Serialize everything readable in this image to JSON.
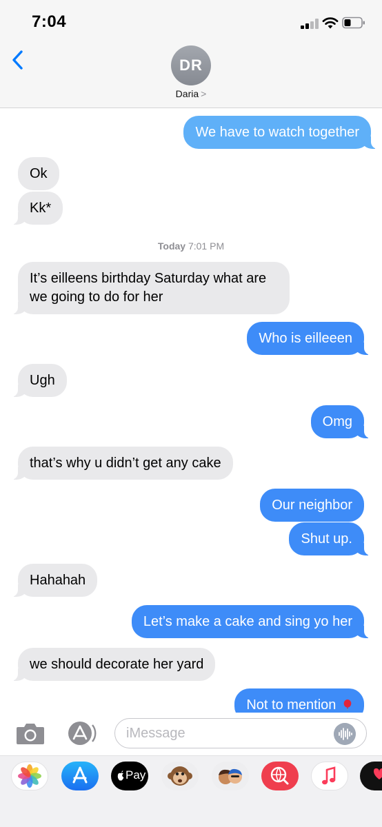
{
  "status_bar": {
    "time": "7:04"
  },
  "header": {
    "avatar_initials": "DR",
    "contact_name": "Daria",
    "contact_chevron": ">"
  },
  "messages": [
    {
      "text": "We have to watch together",
      "direction": "outgoing"
    },
    {
      "text": "Ok",
      "direction": "incoming"
    },
    {
      "text": "Kk*",
      "direction": "incoming"
    },
    {
      "text": "It’s eilleens birthday Saturday what are we going to do for her",
      "direction": "incoming"
    },
    {
      "text": "Who is eilleeen",
      "direction": "outgoing"
    },
    {
      "text": "Ugh",
      "direction": "incoming"
    },
    {
      "text": "Omg",
      "direction": "outgoing"
    },
    {
      "text": "that’s why u didn’t get any cake",
      "direction": "incoming"
    },
    {
      "text": "Our neighbor",
      "direction": "outgoing"
    },
    {
      "text": "Shut up.",
      "direction": "outgoing"
    },
    {
      "text": "Hahahah",
      "direction": "incoming"
    },
    {
      "text": "Let’s make a cake and sing yo her",
      "direction": "outgoing"
    },
    {
      "text": "we should decorate her yard",
      "direction": "incoming"
    },
    {
      "text": "Not to mention",
      "direction": "outgoing",
      "emoji": "balloon"
    }
  ],
  "timestamp": {
    "day": "Today",
    "time": "7:01 PM"
  },
  "input_bar": {
    "placeholder": "iMessage"
  },
  "app_drawer": {
    "items": [
      {
        "name": "photos",
        "icon": "photos-icon"
      },
      {
        "name": "app-store",
        "icon": "app-store-icon"
      },
      {
        "name": "apple-pay",
        "icon": "apple-pay-icon",
        "label": "Pay"
      },
      {
        "name": "animoji",
        "icon": "monkey-animoji-icon"
      },
      {
        "name": "memoji-stickers",
        "icon": "memoji-stickers-icon"
      },
      {
        "name": "web-images",
        "icon": "globe-search-icon"
      },
      {
        "name": "music",
        "icon": "music-note-icon"
      },
      {
        "name": "digital-touch",
        "icon": "digital-touch-icon"
      }
    ]
  },
  "colors": {
    "outgoing_bubble": "#3e8cf8",
    "outgoing_bubble_faded": "#5fb0f8",
    "incoming_bubble": "#e9e9eb",
    "accent": "#007aff"
  }
}
